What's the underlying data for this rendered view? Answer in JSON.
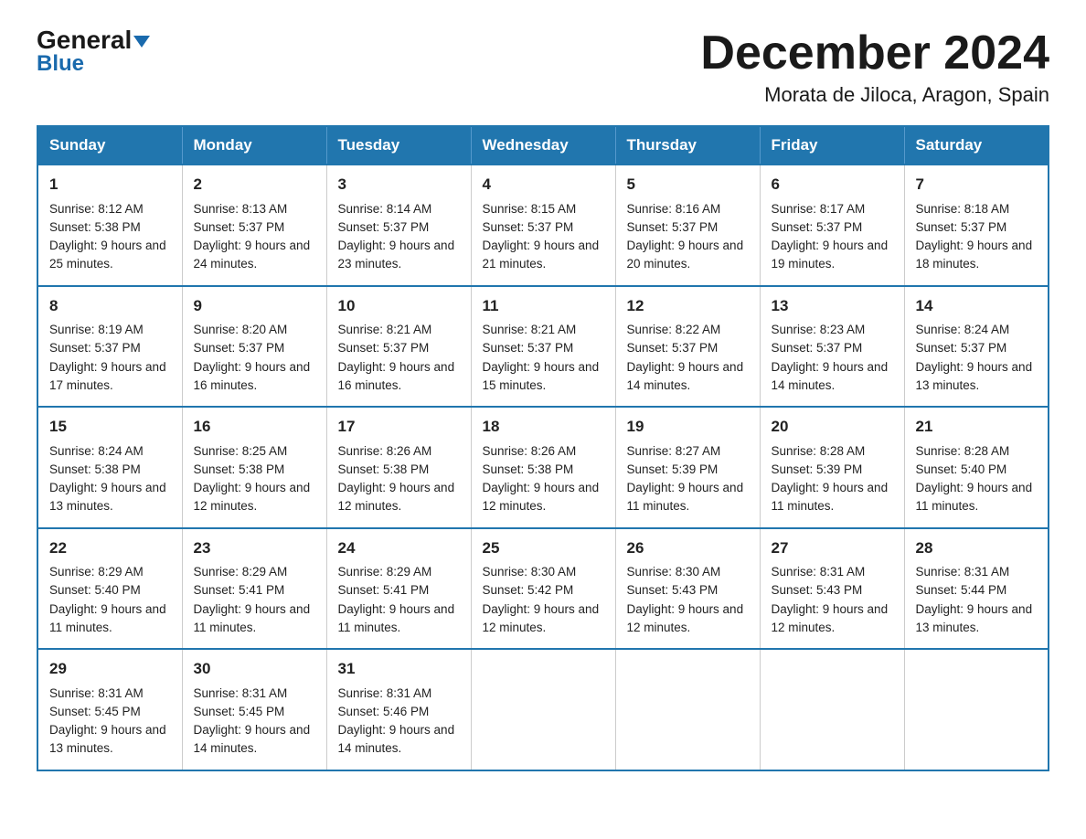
{
  "header": {
    "logo_general": "General",
    "logo_blue": "Blue",
    "month_title": "December 2024",
    "location": "Morata de Jiloca, Aragon, Spain"
  },
  "days_of_week": [
    "Sunday",
    "Monday",
    "Tuesday",
    "Wednesday",
    "Thursday",
    "Friday",
    "Saturday"
  ],
  "weeks": [
    [
      {
        "day": "1",
        "sunrise": "8:12 AM",
        "sunset": "5:38 PM",
        "daylight": "9 hours and 25 minutes."
      },
      {
        "day": "2",
        "sunrise": "8:13 AM",
        "sunset": "5:37 PM",
        "daylight": "9 hours and 24 minutes."
      },
      {
        "day": "3",
        "sunrise": "8:14 AM",
        "sunset": "5:37 PM",
        "daylight": "9 hours and 23 minutes."
      },
      {
        "day": "4",
        "sunrise": "8:15 AM",
        "sunset": "5:37 PM",
        "daylight": "9 hours and 21 minutes."
      },
      {
        "day": "5",
        "sunrise": "8:16 AM",
        "sunset": "5:37 PM",
        "daylight": "9 hours and 20 minutes."
      },
      {
        "day": "6",
        "sunrise": "8:17 AM",
        "sunset": "5:37 PM",
        "daylight": "9 hours and 19 minutes."
      },
      {
        "day": "7",
        "sunrise": "8:18 AM",
        "sunset": "5:37 PM",
        "daylight": "9 hours and 18 minutes."
      }
    ],
    [
      {
        "day": "8",
        "sunrise": "8:19 AM",
        "sunset": "5:37 PM",
        "daylight": "9 hours and 17 minutes."
      },
      {
        "day": "9",
        "sunrise": "8:20 AM",
        "sunset": "5:37 PM",
        "daylight": "9 hours and 16 minutes."
      },
      {
        "day": "10",
        "sunrise": "8:21 AM",
        "sunset": "5:37 PM",
        "daylight": "9 hours and 16 minutes."
      },
      {
        "day": "11",
        "sunrise": "8:21 AM",
        "sunset": "5:37 PM",
        "daylight": "9 hours and 15 minutes."
      },
      {
        "day": "12",
        "sunrise": "8:22 AM",
        "sunset": "5:37 PM",
        "daylight": "9 hours and 14 minutes."
      },
      {
        "day": "13",
        "sunrise": "8:23 AM",
        "sunset": "5:37 PM",
        "daylight": "9 hours and 14 minutes."
      },
      {
        "day": "14",
        "sunrise": "8:24 AM",
        "sunset": "5:37 PM",
        "daylight": "9 hours and 13 minutes."
      }
    ],
    [
      {
        "day": "15",
        "sunrise": "8:24 AM",
        "sunset": "5:38 PM",
        "daylight": "9 hours and 13 minutes."
      },
      {
        "day": "16",
        "sunrise": "8:25 AM",
        "sunset": "5:38 PM",
        "daylight": "9 hours and 12 minutes."
      },
      {
        "day": "17",
        "sunrise": "8:26 AM",
        "sunset": "5:38 PM",
        "daylight": "9 hours and 12 minutes."
      },
      {
        "day": "18",
        "sunrise": "8:26 AM",
        "sunset": "5:38 PM",
        "daylight": "9 hours and 12 minutes."
      },
      {
        "day": "19",
        "sunrise": "8:27 AM",
        "sunset": "5:39 PM",
        "daylight": "9 hours and 11 minutes."
      },
      {
        "day": "20",
        "sunrise": "8:28 AM",
        "sunset": "5:39 PM",
        "daylight": "9 hours and 11 minutes."
      },
      {
        "day": "21",
        "sunrise": "8:28 AM",
        "sunset": "5:40 PM",
        "daylight": "9 hours and 11 minutes."
      }
    ],
    [
      {
        "day": "22",
        "sunrise": "8:29 AM",
        "sunset": "5:40 PM",
        "daylight": "9 hours and 11 minutes."
      },
      {
        "day": "23",
        "sunrise": "8:29 AM",
        "sunset": "5:41 PM",
        "daylight": "9 hours and 11 minutes."
      },
      {
        "day": "24",
        "sunrise": "8:29 AM",
        "sunset": "5:41 PM",
        "daylight": "9 hours and 11 minutes."
      },
      {
        "day": "25",
        "sunrise": "8:30 AM",
        "sunset": "5:42 PM",
        "daylight": "9 hours and 12 minutes."
      },
      {
        "day": "26",
        "sunrise": "8:30 AM",
        "sunset": "5:43 PM",
        "daylight": "9 hours and 12 minutes."
      },
      {
        "day": "27",
        "sunrise": "8:31 AM",
        "sunset": "5:43 PM",
        "daylight": "9 hours and 12 minutes."
      },
      {
        "day": "28",
        "sunrise": "8:31 AM",
        "sunset": "5:44 PM",
        "daylight": "9 hours and 13 minutes."
      }
    ],
    [
      {
        "day": "29",
        "sunrise": "8:31 AM",
        "sunset": "5:45 PM",
        "daylight": "9 hours and 13 minutes."
      },
      {
        "day": "30",
        "sunrise": "8:31 AM",
        "sunset": "5:45 PM",
        "daylight": "9 hours and 14 minutes."
      },
      {
        "day": "31",
        "sunrise": "8:31 AM",
        "sunset": "5:46 PM",
        "daylight": "9 hours and 14 minutes."
      },
      null,
      null,
      null,
      null
    ]
  ]
}
